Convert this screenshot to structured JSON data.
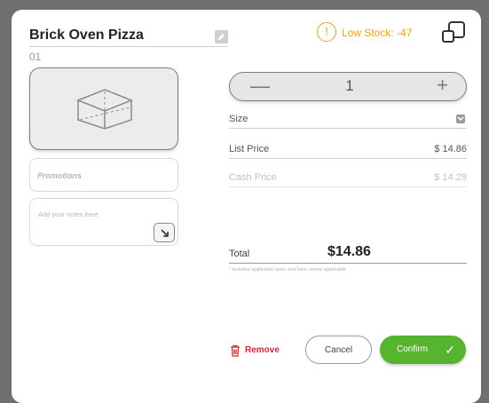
{
  "item": {
    "title": "Brick Oven Pizza",
    "number": "01",
    "promotions_label": "Promotions",
    "notes_placeholder": "Add your notes here"
  },
  "stock": {
    "warning_label": "Low Stock: -47",
    "color": "#e8a21d"
  },
  "quantity": {
    "value": "1",
    "minus_label": "—",
    "plus_label": "+"
  },
  "pricing": {
    "size_label": "Size",
    "list_price_label": "List Price",
    "list_price_value": "$ 14.86",
    "cash_price_label": "Cash Price",
    "cash_price_value": "$ 14.29",
    "total_label": "Total",
    "total_value": "$14.86",
    "disclaimer": "* includes applicable taxes and fees, where applicable"
  },
  "actions": {
    "remove_label": "Remove",
    "cancel_label": "Cancel",
    "confirm_label": "Confirm",
    "confirm_glyph": "✓"
  },
  "icons": {
    "edit": "edit-pencil-icon",
    "image_placeholder": "box-placeholder-icon",
    "expand": "expand-arrow-icon",
    "warning": "exclamation-circle-icon",
    "corner": "split-window-icon",
    "chevron": "chevron-down-icon",
    "trash": "trash-icon",
    "check": "checkmark-icon"
  },
  "colors": {
    "accent_green": "#57b42e",
    "remove_red": "#c72b3a",
    "warning_orange": "#e8a21d"
  }
}
